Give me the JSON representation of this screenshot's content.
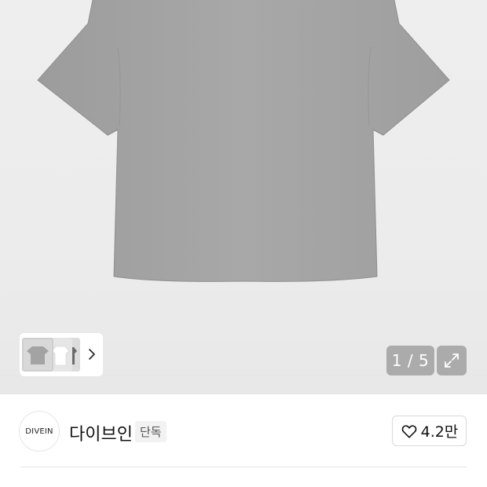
{
  "gallery": {
    "counter": "1 / 5",
    "current_page": 1,
    "total_pages": 5,
    "icons": {
      "next": "chevron-right-icon",
      "expand": "expand-arrows-icon"
    },
    "product_color": "#a6a6a6"
  },
  "brand": {
    "logo_text": "DIVEIN",
    "name": "다이브인",
    "badge": "단독",
    "like_count": "4.2만",
    "like_icon": "heart-outline-icon"
  }
}
